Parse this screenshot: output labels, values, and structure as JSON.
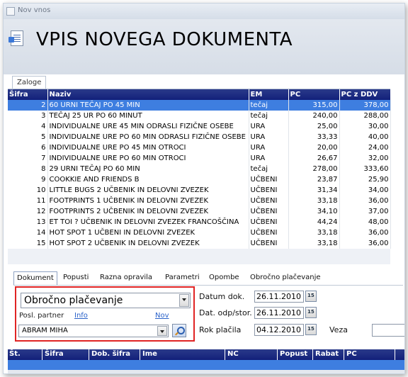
{
  "window": {
    "title": "Nov vnos"
  },
  "header": {
    "title": "VPIS NOVEGA DOKUMENTA"
  },
  "top_tab": {
    "label": "Zaloge"
  },
  "grid": {
    "columns": [
      "Šifra",
      "Naziv",
      "EM",
      "PC",
      "PC z DDV"
    ],
    "rows": [
      [
        "2",
        "60 URNI TEČAJ PO 45 MIN",
        "tečaj",
        "315,00",
        "378,00"
      ],
      [
        "3",
        "TEČAJ 25 UR PO 60 MINUT",
        "tečaj",
        "240,00",
        "288,00"
      ],
      [
        "4",
        "INDIVIDUALNE URE 45 MIN ODRASLI  FIZIČNE OSEBE",
        "URA",
        "25,00",
        "30,00"
      ],
      [
        "5",
        "INDIVIDUALNE URE PO 60 MIN ODRASLI  FIZIČNE OSEBE",
        "URA",
        "33,33",
        "40,00"
      ],
      [
        "6",
        "INDIVIDUALNE URE PO 45 MIN OTROCI",
        "URA",
        "20,00",
        "24,00"
      ],
      [
        "7",
        "INDIVIDUALNE URE PO 60 MIN OTROCI",
        "URA",
        "26,67",
        "32,00"
      ],
      [
        "8",
        "29 URNI TEČAJ PO 60 MIN",
        "tečaj",
        "278,00",
        "333,60"
      ],
      [
        "9",
        "COOKKIE AND FRIENDS B",
        "UČBENI",
        "23,87",
        "25,90"
      ],
      [
        "10",
        "LITTLE BUGS 2 UČBENIK IN DELOVNI ZVEZEK",
        "UČBENI",
        "31,34",
        "34,00"
      ],
      [
        "11",
        "FOOTPRINTS 1  UČBENIK IN  DELOVNI  ZVEZEK",
        "UČBENI",
        "33,18",
        "36,00"
      ],
      [
        "12",
        "FOOTPRINTS 2  UČBENIK IN DELOVNI ZVEZEK",
        "UČBENI",
        "34,10",
        "37,00"
      ],
      [
        "13",
        "ET TOI ? UČBENIK IN DELOVNI ZVEZEK FRANCOŠČINA",
        "UČBENI",
        "44,24",
        "48,00"
      ],
      [
        "14",
        "HOT SPOT 1  UČBENI IN DELOVNI ZVEZEK",
        "UČBENI",
        "33,18",
        "36,00"
      ],
      [
        "15",
        "HOT SPOT 2 UČBENIK IN DELOVNI ZVEZEK",
        "UČBENI",
        "33,18",
        "36,00"
      ]
    ]
  },
  "bottom_tabs": [
    "Dokument",
    "Popusti",
    "Razna opravila",
    "Parametri",
    "Opombe",
    "Obročno plačevanje"
  ],
  "doc_form": {
    "payment_type": "Obročno plačevanje",
    "partner_label": "Posl. partner",
    "info_link": "Info",
    "new_link": "Nov",
    "partner_value": "ABRAM MIHA"
  },
  "dates": {
    "doc_date_label": "Datum dok.",
    "doc_date": "26.11.2010",
    "ship_date_label": "Dat. odp/stor.",
    "ship_date": "26.11.2010",
    "due_date_label": "Rok plačila",
    "due_date": "04.12.2010",
    "veza_label": "Veza"
  },
  "bottom_grid": {
    "columns": [
      "Št.",
      "Šifra",
      "Dob. šifra",
      "Ime",
      "NC",
      "Popust",
      "Rabat",
      "PC"
    ]
  }
}
